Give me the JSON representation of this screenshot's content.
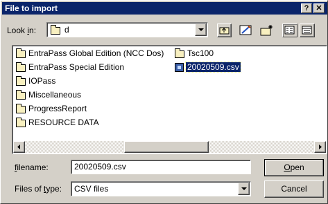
{
  "window": {
    "title": "File to import",
    "help_label": "?",
    "close_label": "✕"
  },
  "lookin": {
    "label_pre": "Look ",
    "label_key": "i",
    "label_post": "n:",
    "value": "d"
  },
  "toolbar": {
    "icons": [
      "up-folder-icon",
      "desktop-icon",
      "new-folder-icon",
      "list-view-icon",
      "details-view-icon"
    ]
  },
  "files": [
    {
      "name": "EntraPass Global Edition (NCC Dos)",
      "type": "folder"
    },
    {
      "name": "EntraPass Special Edition",
      "type": "folder"
    },
    {
      "name": "IOPass",
      "type": "folder"
    },
    {
      "name": "Miscellaneous",
      "type": "folder"
    },
    {
      "name": "ProgressReport",
      "type": "folder"
    },
    {
      "name": "RESOURCE DATA",
      "type": "folder"
    },
    {
      "name": "Tsc100",
      "type": "folder"
    },
    {
      "name": "20020509.csv",
      "type": "csv",
      "selected": true
    }
  ],
  "filename": {
    "label_key": "f",
    "label_post": "ilename:",
    "value": "20020509.csv"
  },
  "filetype": {
    "label_pre": "Files of ",
    "label_key": "t",
    "label_post": "ype:",
    "value": "CSV files"
  },
  "buttons": {
    "open_key": "O",
    "open_post": "pen",
    "cancel": "Cancel"
  },
  "colors": {
    "face": "#d4d0c8",
    "title": "#0a246a",
    "selection": "#0a246a"
  }
}
